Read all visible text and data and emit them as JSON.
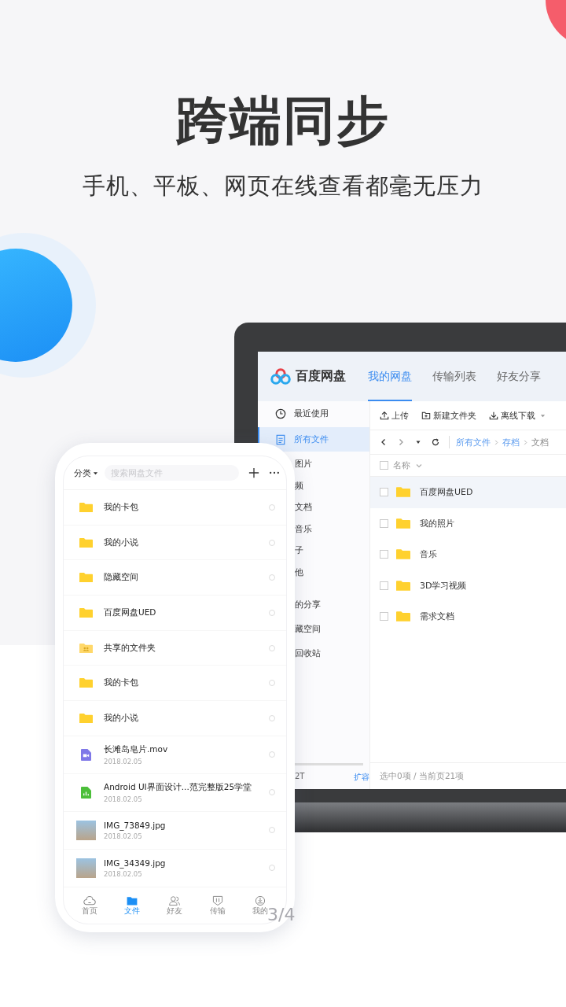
{
  "headline": "跨端同步",
  "subheadline": "手机、平板、网页在线查看都毫无压力",
  "desktop": {
    "brand": "百度网盘",
    "tabs": [
      {
        "label": "我的网盘",
        "selected": true
      },
      {
        "label": "传输列表",
        "selected": false
      },
      {
        "label": "好友分享",
        "selected": false
      }
    ],
    "sidebar": [
      {
        "label": "最近使用",
        "kind": "clock",
        "selected": false
      },
      {
        "label": "所有文件",
        "kind": "doc",
        "selected": true
      },
      {
        "label": "图片",
        "kind": "sub",
        "selected": false
      },
      {
        "label": "频",
        "kind": "sub",
        "selected": false
      },
      {
        "label": "文档",
        "kind": "sub",
        "selected": false
      },
      {
        "label": "音乐",
        "kind": "sub",
        "selected": false
      },
      {
        "label": "子",
        "kind": "sub",
        "selected": false
      },
      {
        "label": "他",
        "kind": "sub",
        "selected": false
      },
      {
        "label": "的分享",
        "kind": "group",
        "selected": false
      },
      {
        "label": "藏空间",
        "kind": "group",
        "selected": false
      },
      {
        "label": "回收站",
        "kind": "group",
        "selected": false
      }
    ],
    "storage": "2T",
    "expand_link": "扩容",
    "toolbar": [
      {
        "label": "上传",
        "kind": "upload"
      },
      {
        "label": "新建文件夹",
        "kind": "folder"
      },
      {
        "label": "离线下载",
        "kind": "download"
      }
    ],
    "breadcrumb": [
      {
        "label": "所有文件",
        "kind": "link"
      },
      {
        "label": "存档",
        "kind": "link"
      },
      {
        "label": "文档",
        "kind": "current"
      }
    ],
    "column": "名称",
    "select_all": {
      "checked": false
    },
    "rows": [
      {
        "name": "百度网盘UED",
        "selected": true,
        "checked": false
      },
      {
        "name": "我的照片",
        "selected": false,
        "checked": false
      },
      {
        "name": "音乐",
        "selected": false,
        "checked": false
      },
      {
        "name": "3D学习视频",
        "selected": false,
        "checked": false
      },
      {
        "name": "需求文档",
        "selected": false,
        "checked": false
      }
    ],
    "footer": "选中0项 / 当前页21项"
  },
  "phone": {
    "category": "分类",
    "search": {
      "placeholder": "搜索网盘文件"
    },
    "files": [
      {
        "name": "我的卡包",
        "kind": "folder",
        "selected": false
      },
      {
        "name": "我的小说",
        "kind": "folder",
        "selected": false
      },
      {
        "name": "隐藏空间",
        "kind": "folder",
        "selected": false
      },
      {
        "name": "百度网盘UED",
        "kind": "folder",
        "selected": false
      },
      {
        "name": "共享的文件夹",
        "kind": "shared",
        "selected": false
      },
      {
        "name": "我的卡包",
        "kind": "folder",
        "selected": false
      },
      {
        "name": "我的小说",
        "kind": "folder",
        "selected": false
      },
      {
        "name": "长滩岛皂片.mov",
        "date": "2018.02.05",
        "kind": "video",
        "selected": false
      },
      {
        "name": "Android UI界面设计...范完整版25学堂",
        "date": "2018.02.05",
        "kind": "sheet",
        "selected": false
      },
      {
        "name": "IMG_73849.jpg",
        "date": "2018.02.05",
        "kind": "image",
        "selected": false
      },
      {
        "name": "IMG_34349.jpg",
        "date": "2018.02.05",
        "kind": "image",
        "selected": false
      }
    ],
    "nav": [
      {
        "label": "首页",
        "kind": "cloud",
        "selected": false
      },
      {
        "label": "文件",
        "kind": "files",
        "selected": true
      },
      {
        "label": "好友",
        "kind": "friends",
        "selected": false
      },
      {
        "label": "传输",
        "kind": "transfer",
        "selected": false
      },
      {
        "label": "我的",
        "kind": "me",
        "selected": false
      }
    ]
  },
  "page_indicator": "3/4"
}
